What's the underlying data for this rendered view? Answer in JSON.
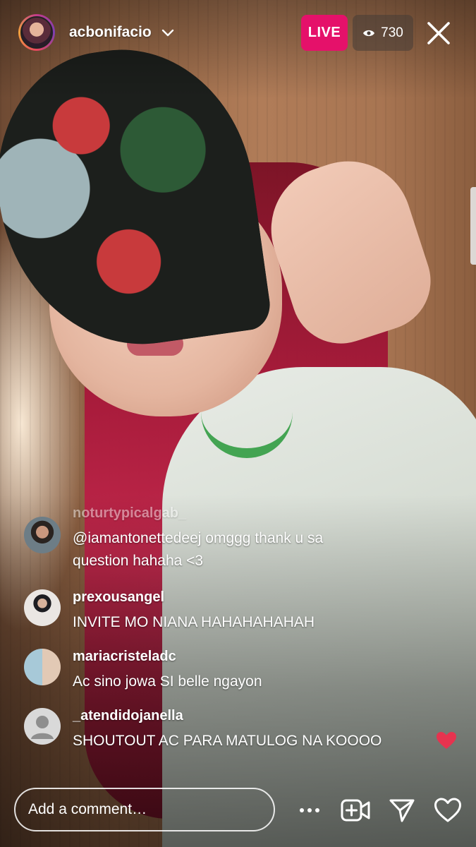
{
  "header": {
    "username": "acbonifacio",
    "live_label": "LIVE",
    "viewer_count": "730"
  },
  "comments": [
    {
      "user": "noturtypicalgab_",
      "text": "@iamantonettedeej omggg thank u sa question hahaha <3",
      "faded_user": true
    },
    {
      "user": "prexousangel",
      "text": "INVITE MO NIANA HAHAHAHAHAH"
    },
    {
      "user": "mariacristeladc",
      "text": "Ac sino jowa SI belle ngayon"
    },
    {
      "user": "_atendidojanella",
      "text": "SHOUTOUT AC PARA MATULOG NA KOOOO"
    }
  ],
  "input": {
    "placeholder": "Add a comment…"
  },
  "icons": {
    "more": "more-icon",
    "add_video": "add-guest-video-icon",
    "share": "share-icon",
    "like": "heart-icon",
    "close": "close-icon",
    "viewers": "eye-icon"
  },
  "colors": {
    "live_badge": "#e5116a",
    "heart": "#e6334f"
  }
}
